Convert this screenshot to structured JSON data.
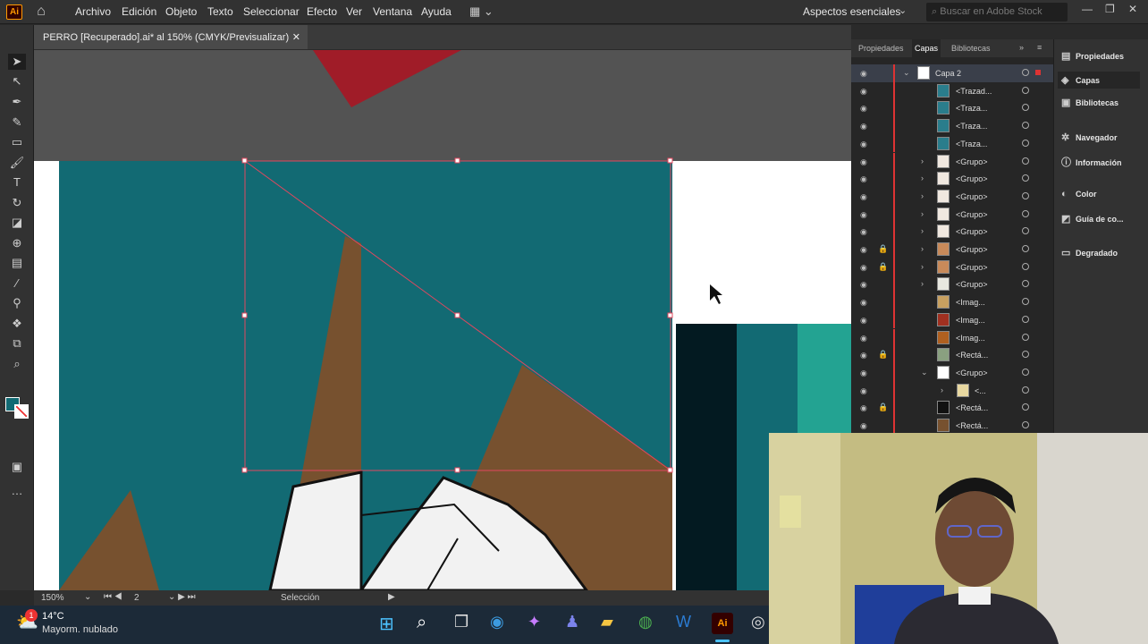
{
  "menubar": {
    "logo": "Ai",
    "items": [
      "Archivo",
      "Edición",
      "Objeto",
      "Texto",
      "Seleccionar",
      "Efecto",
      "Ver",
      "Ventana",
      "Ayuda"
    ],
    "workspace": "Aspectos esenciales",
    "search_placeholder": "Buscar en Adobe Stock"
  },
  "document": {
    "tab_title": "PERRO [Recuperado].ai* al 150% (CMYK/Previsualizar)"
  },
  "statusbar": {
    "zoom": "150%",
    "artboard": "2",
    "tool": "Selección"
  },
  "panel_tabs": [
    "Propiedades",
    "Capas",
    "Bibliotecas"
  ],
  "layers": {
    "top": "Capa 2",
    "rows": [
      {
        "label": "<Trazad...",
        "locked": false,
        "expand": ""
      },
      {
        "label": "<Traza...",
        "locked": false,
        "expand": ""
      },
      {
        "label": "<Traza...",
        "locked": false,
        "expand": ""
      },
      {
        "label": "<Traza...",
        "locked": false,
        "expand": ""
      },
      {
        "label": "<Grupo>",
        "locked": false,
        "expand": "›"
      },
      {
        "label": "<Grupo>",
        "locked": false,
        "expand": "›"
      },
      {
        "label": "<Grupo>",
        "locked": false,
        "expand": "›"
      },
      {
        "label": "<Grupo>",
        "locked": false,
        "expand": "›"
      },
      {
        "label": "<Grupo>",
        "locked": false,
        "expand": "›"
      },
      {
        "label": "<Grupo>",
        "locked": true,
        "expand": "›"
      },
      {
        "label": "<Grupo>",
        "locked": true,
        "expand": "›"
      },
      {
        "label": "<Grupo>",
        "locked": false,
        "expand": "›"
      },
      {
        "label": "<Imag...",
        "locked": false,
        "expand": ""
      },
      {
        "label": "<Imag...",
        "locked": false,
        "expand": ""
      },
      {
        "label": "<Imag...",
        "locked": false,
        "expand": ""
      },
      {
        "label": "<Rectá...",
        "locked": true,
        "expand": ""
      },
      {
        "label": "<Grupo>",
        "locked": false,
        "expand": "⌄"
      },
      {
        "label": "<...",
        "locked": false,
        "expand": "›"
      },
      {
        "label": "<Rectá...",
        "locked": true,
        "expand": ""
      },
      {
        "label": "<Rectá...",
        "locked": false,
        "expand": ""
      }
    ]
  },
  "dock": [
    "Propiedades",
    "Capas",
    "Bibliotecas",
    "Navegador",
    "Información",
    "Color",
    "Guía de co...",
    "Degradado"
  ],
  "taskbar": {
    "temp": "14°C",
    "weather": "Mayorm. nublado",
    "badge": "1"
  },
  "colors": {
    "teal": "#126a73",
    "brown": "#77512f",
    "selection": "#e0485f",
    "accent": "#ff9a00"
  }
}
